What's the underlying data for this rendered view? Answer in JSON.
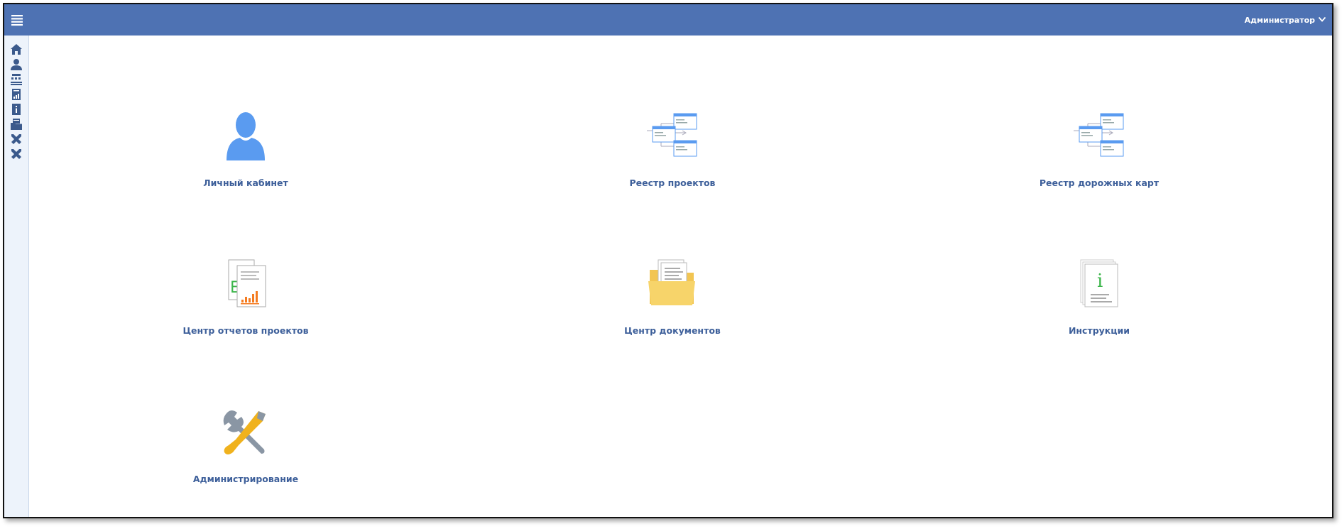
{
  "header": {
    "menu_icon": "hamburger-menu-icon",
    "user_name": "Администратор",
    "user_menu_icon": "chevron-down-icon"
  },
  "sidebar": {
    "icons": [
      "home-icon",
      "user-icon",
      "structure-icon",
      "report-icon",
      "info-icon",
      "folder-icon",
      "tools-icon",
      "admin-tools-icon"
    ]
  },
  "tiles": [
    {
      "label": "Личный кабинет",
      "icon": "user-profile-icon"
    },
    {
      "label": "Реестр проектов",
      "icon": "project-registry-icon"
    },
    {
      "label": "Реестр дорожных карт",
      "icon": "roadmap-registry-icon"
    },
    {
      "label": "Центр отчетов проектов",
      "icon": "reports-center-icon"
    },
    {
      "label": "Центр документов",
      "icon": "documents-folder-icon"
    },
    {
      "label": "Инструкции",
      "icon": "instructions-icon"
    },
    {
      "label": "Администрирование",
      "icon": "administration-tools-icon"
    }
  ],
  "colors": {
    "header_bg": "#4e72b3",
    "label_color": "#3d5f9a",
    "icon_blue": "#5a9bf0"
  }
}
